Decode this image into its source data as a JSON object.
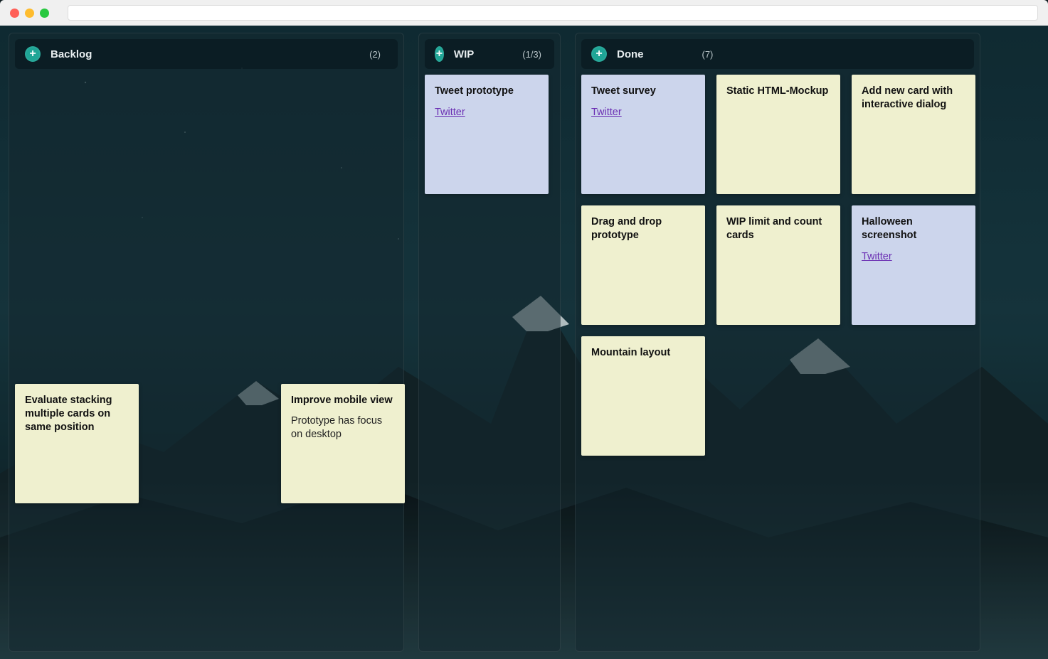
{
  "columns": {
    "backlog": {
      "title": "Backlog",
      "count": "(2)",
      "cards": [
        {
          "title": "Evaluate stacking multiple cards on same position",
          "body": "",
          "link": ""
        },
        {
          "title": "Improve mobile view",
          "body": "Prototype has focus on desktop",
          "link": ""
        }
      ]
    },
    "wip": {
      "title": "WIP",
      "count": "(1/3)",
      "cards": [
        {
          "title": "Tweet prototype",
          "body": "",
          "link": "Twitter"
        }
      ]
    },
    "done": {
      "title": "Done",
      "count": "(7)",
      "cards": [
        {
          "title": "Tweet survey",
          "body": "",
          "link": "Twitter",
          "color": "blue"
        },
        {
          "title": "Static HTML-Mockup",
          "body": "",
          "link": "",
          "color": "yellow"
        },
        {
          "title": "Add new card with interactive dialog",
          "body": "",
          "link": "",
          "color": "yellow"
        },
        {
          "title": "Drag and drop prototype",
          "body": "",
          "link": "",
          "color": "yellow"
        },
        {
          "title": "WIP limit and count cards",
          "body": "",
          "link": "",
          "color": "yellow"
        },
        {
          "title": "Halloween screenshot",
          "body": "",
          "link": "Twitter",
          "color": "blue"
        },
        {
          "title": "Mountain layout",
          "body": "",
          "link": "",
          "color": "yellow"
        }
      ]
    }
  },
  "plus_glyph": "+"
}
